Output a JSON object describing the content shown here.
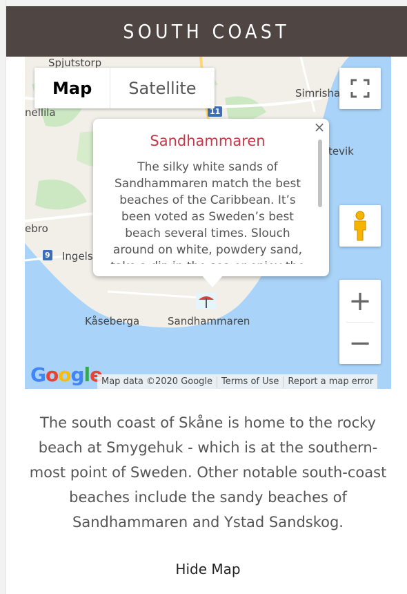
{
  "header": {
    "title": "SOUTH COAST"
  },
  "map": {
    "type_control": {
      "map_label": "Map",
      "satellite_label": "Satellite"
    },
    "places": [
      "Spjutstorp",
      "Simrishamn",
      "nellila",
      "tevik",
      "ebro",
      "Ingelstad",
      "Kåseberga",
      "Sandhammaren"
    ],
    "road_badges": [
      "11",
      "9"
    ],
    "info_window": {
      "title": "Sandhammaren",
      "body": "The silky white sands of Sandhammaren match the best beaches of the Caribbean. It’s been voted as Sweden’s best beach several times. Slouch around on white, powdery sand, take a dip in the sea or enjoy the sun."
    },
    "logo": "Google",
    "attribution": {
      "data": "Map data ©2020 Google",
      "terms": "Terms of Use",
      "report": "Report a map error"
    },
    "colors": {
      "water": "#a9d3f8",
      "land": "#f2efe9",
      "parks": "#cce8c3",
      "title_accent": "#c0394a"
    }
  },
  "description": "The south coast of Skåne is home to the rocky beach at Smygehuk - which is at the southern-most point of Sweden. Other notable south-coast beaches include the sandy beaches of Sandhammaren and Ystad Sandskog.",
  "hide_map_label": "Hide Map"
}
